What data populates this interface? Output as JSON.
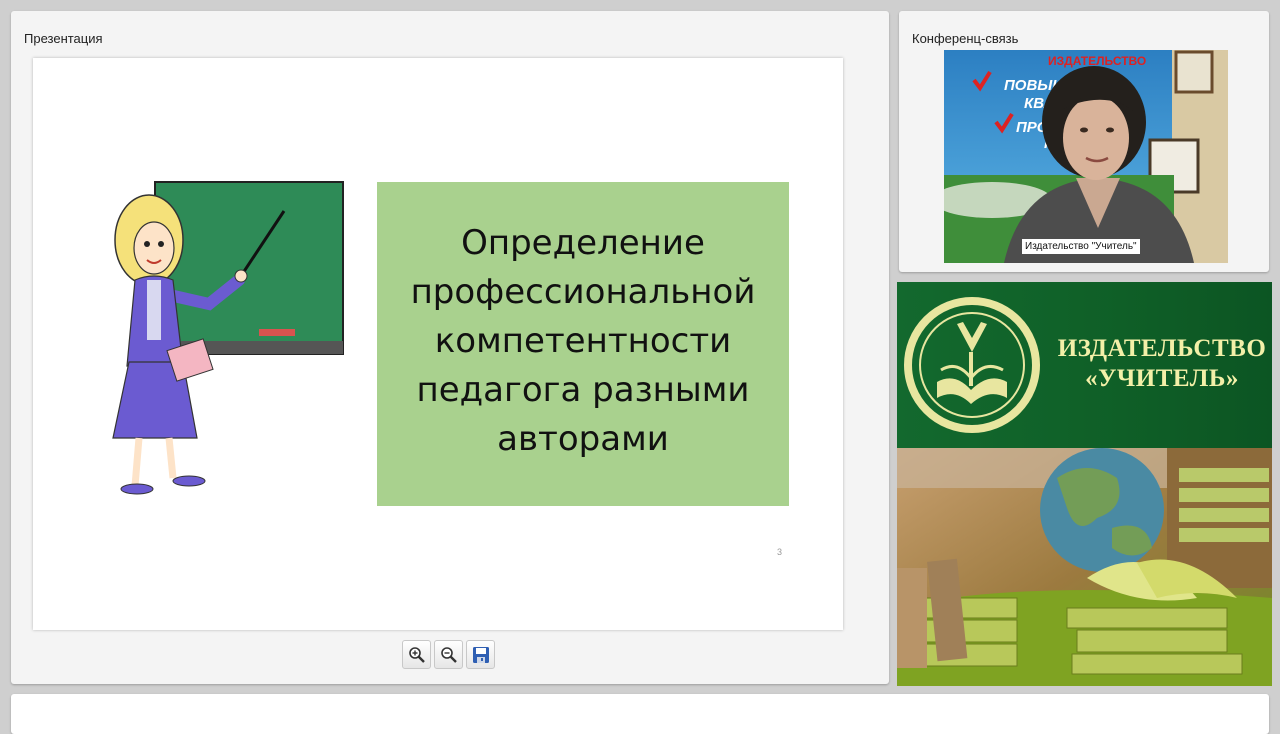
{
  "presentation": {
    "title": "Презентация",
    "slide": {
      "heading_lines": [
        "Определение",
        "профессиональной",
        "компетентности",
        "педагога разными",
        "авторами"
      ],
      "page_number": "3"
    },
    "toolbar": [
      {
        "icon": "zoom-in-icon"
      },
      {
        "icon": "zoom-out-icon"
      },
      {
        "icon": "save-icon"
      }
    ]
  },
  "conference": {
    "title": "Конференц-связь",
    "participant_label": "Издательство \"Учитель\"",
    "background_banner": {
      "publisher": "ИЗДАТЕЛЬСТВО",
      "line1": "ПОВЫШЕН",
      "line2": "КВАЛ",
      "line3": "ПРОФ",
      "line4": "ПЕ"
    }
  },
  "publisher_banner": {
    "line1": "ИЗДАТЕЛЬСТВО",
    "line2": "«УЧИТЕЛЬ»"
  },
  "colors": {
    "slide_box": "#a9d18e",
    "banner_green": "#13692e",
    "banner_text": "#f3f0a8"
  }
}
